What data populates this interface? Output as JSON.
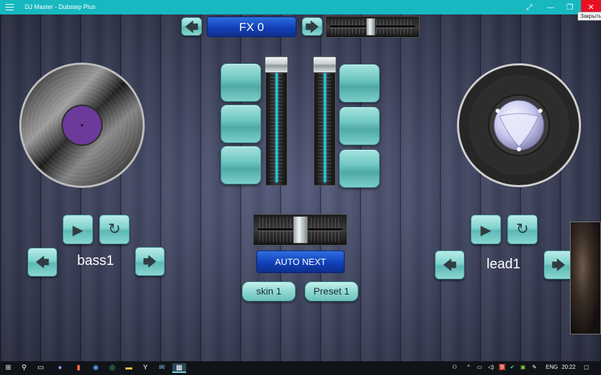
{
  "window": {
    "title": "DJ Master - Dubstep Plus",
    "tooltip": "Закрыть",
    "menu_icon": "hamburger-icon",
    "fullscreen_icon": "fullscreen-icon",
    "minimize_icon": "minimize-icon",
    "restore_icon": "restore-icon",
    "close_icon": "close-icon"
  },
  "fx": {
    "label": "FX 0",
    "prev_icon": "arrow-left-icon",
    "next_icon": "arrow-right-icon",
    "slider_level": 0.48
  },
  "center": {
    "left_fader_level": 1.0,
    "right_fader_level": 1.0,
    "crossfader_level": 0.5,
    "auto_next_label": "AUTO NEXT",
    "skin_label": "skin 1",
    "preset_label": "Preset 1"
  },
  "deck_left": {
    "track_label": "bass1",
    "play_icon": "play-icon",
    "repeat_icon": "repeat-icon",
    "prev_icon": "arrow-left-icon",
    "next_icon": "arrow-right-icon",
    "label_color": "#6b3a9a"
  },
  "deck_right": {
    "track_label": "lead1",
    "play_icon": "play-icon",
    "repeat_icon": "repeat-icon",
    "prev_icon": "arrow-left-icon",
    "next_icon": "arrow-right-icon"
  },
  "colors": {
    "titlebar": "#17b8c0",
    "accent_teal": "#7fd2cd",
    "fx_blue": "#1240b8",
    "fader_line": "#2bc6d6"
  },
  "taskbar": {
    "language": "ENG",
    "time": "20:22"
  }
}
